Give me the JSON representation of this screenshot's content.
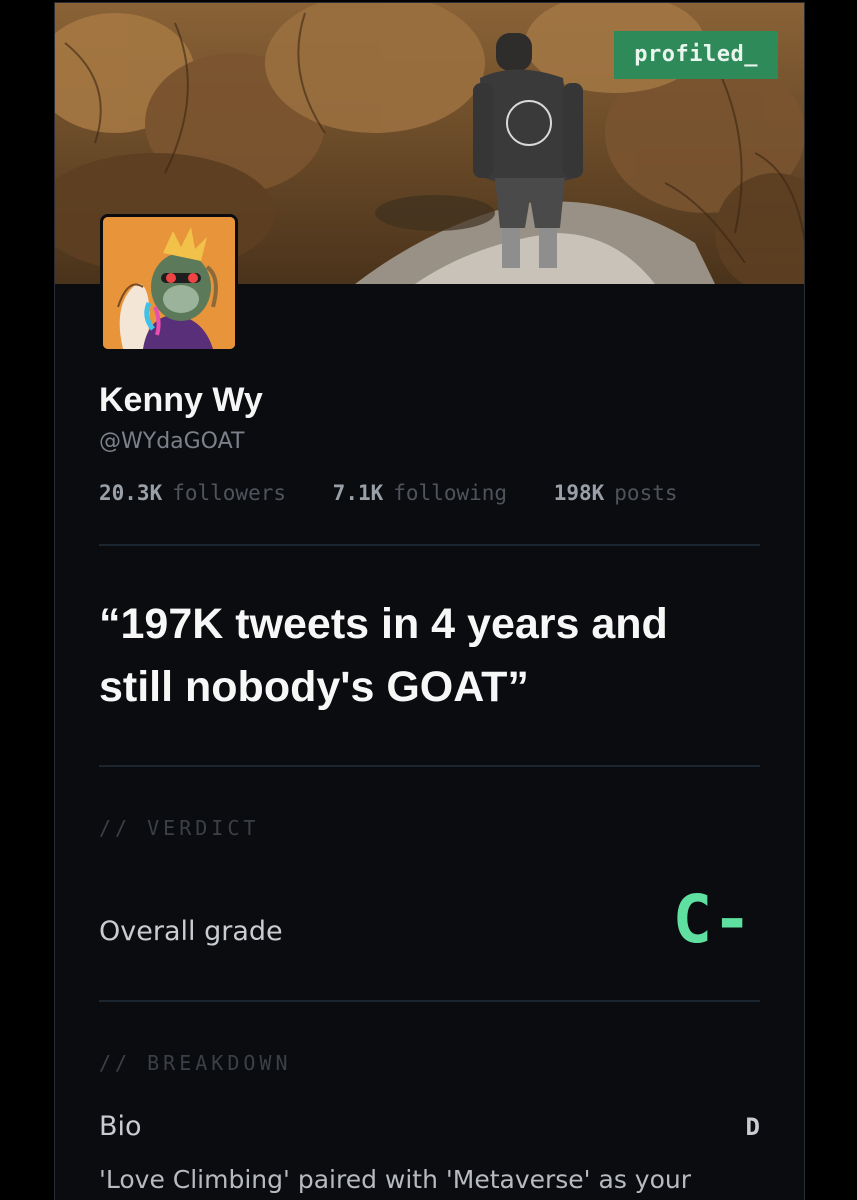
{
  "brand": {
    "label": "profiled_"
  },
  "profile": {
    "name": "Kenny Wy",
    "handle": "@WYdaGOAT",
    "stats": [
      {
        "value": "20.3K",
        "label": "followers"
      },
      {
        "value": "7.1K",
        "label": "following"
      },
      {
        "value": "198K",
        "label": "posts"
      }
    ]
  },
  "quote": "“197K tweets in 4 years and still nobody's GOAT”",
  "verdict": {
    "section_label": "// VERDICT",
    "overall_label": "Overall grade",
    "overall_grade": "C-"
  },
  "breakdown": {
    "section_label": "// BREAKDOWN",
    "items": [
      {
        "label": "Bio",
        "grade": "D",
        "text": "'Love Climbing' paired with 'Metaverse' as your"
      }
    ]
  },
  "colors": {
    "accent_green": "#5fe0a0",
    "badge_green": "#2f8a5a",
    "background": "#0b0c0f"
  },
  "icons": {
    "avatar": "ape-nft-avatar",
    "banner": "forest-hoodie-banner"
  }
}
